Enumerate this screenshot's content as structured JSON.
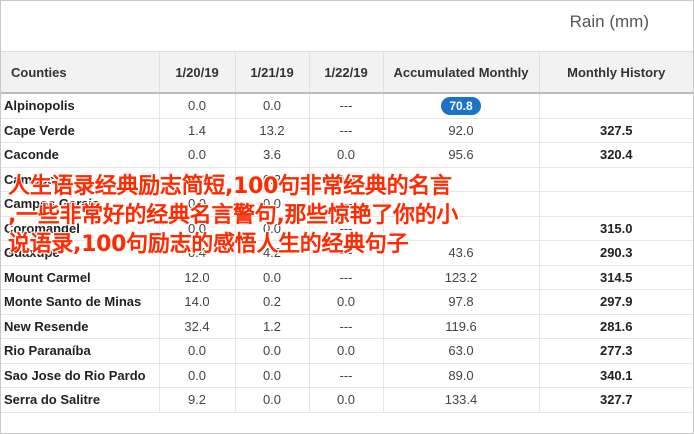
{
  "unit_label": "Rain (mm)",
  "columns": [
    "Counties",
    "1/20/19",
    "1/21/19",
    "1/22/19",
    "Accumulated Monthly",
    "Monthly History"
  ],
  "rows": [
    {
      "name": "Alpinopolis",
      "d1": "0.0",
      "d2": "0.0",
      "d3": "---",
      "acc": "70.8",
      "hist": "",
      "highlight": true
    },
    {
      "name": "Cape Verde",
      "d1": "1.4",
      "d2": "13.2",
      "d3": "---",
      "acc": "92.0",
      "hist": "327.5"
    },
    {
      "name": "Caconde",
      "d1": "0.0",
      "d2": "3.6",
      "d3": "0.0",
      "acc": "95.6",
      "hist": "320.4"
    },
    {
      "name": "Campestre",
      "d1": "0.0",
      "d2": "0.2",
      "d3": "0.0",
      "acc": "",
      "hist": ""
    },
    {
      "name": "Campos Gerais",
      "d1": "0.0",
      "d2": "0.0",
      "d3": "---",
      "acc": "",
      "hist": ""
    },
    {
      "name": "Coromandel",
      "d1": "0.0",
      "d2": "0.0",
      "d3": "---",
      "acc": "",
      "hist": "315.0"
    },
    {
      "name": "Guaxupe",
      "d1": "0.4",
      "d2": "4.2",
      "d3": "---",
      "acc": "43.6",
      "hist": "290.3"
    },
    {
      "name": "Mount Carmel",
      "d1": "12.0",
      "d2": "0.0",
      "d3": "---",
      "acc": "123.2",
      "hist": "314.5"
    },
    {
      "name": "Monte Santo de Minas",
      "d1": "14.0",
      "d2": "0.2",
      "d3": "0.0",
      "acc": "97.8",
      "hist": "297.9"
    },
    {
      "name": "New Resende",
      "d1": "32.4",
      "d2": "1.2",
      "d3": "---",
      "acc": "119.6",
      "hist": "281.6"
    },
    {
      "name": "Rio Paranaíba",
      "d1": "0.0",
      "d2": "0.0",
      "d3": "0.0",
      "acc": "63.0",
      "hist": "277.3"
    },
    {
      "name": "Sao Jose do Rio Pardo",
      "d1": "0.0",
      "d2": "0.0",
      "d3": "---",
      "acc": "89.0",
      "hist": "340.1"
    },
    {
      "name": "Serra do Salitre",
      "d1": "9.2",
      "d2": "0.0",
      "d3": "0.0",
      "acc": "133.4",
      "hist": "327.7"
    }
  ],
  "overlay_lines": [
    "人生语录经典励志简短,100句非常经典的名言",
    ",一些非常好的经典名言警句,那些惊艳了你的小",
    "说语录,100句励志的感悟人生的经典句子"
  ]
}
